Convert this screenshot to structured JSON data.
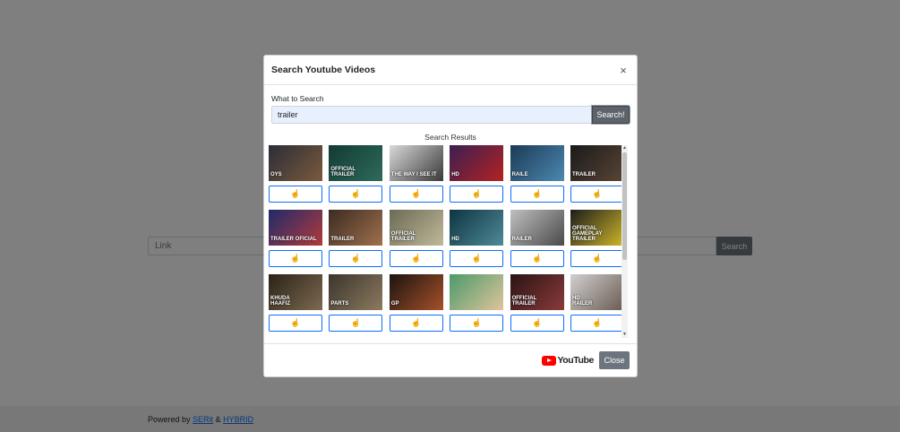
{
  "background": {
    "link_placeholder": "Link",
    "search_label": "Search",
    "footer": {
      "prefix": "Powered by ",
      "link1": "SERit",
      "sep": " & ",
      "link2": "HYBRID"
    }
  },
  "modal": {
    "title": "Search Youtube Videos",
    "close_symbol": "×",
    "field_label": "What to Search",
    "search_value": "trailer",
    "search_button": "Search!",
    "results_title": "Search Results",
    "select_icon": "pointer-hand-icon",
    "results": [
      {
        "thumb_text": "OYS",
        "c1": "#2b2d38",
        "c2": "#7a5a3c"
      },
      {
        "thumb_text": "OFFICIAL\nTRAILER",
        "c1": "#123a34",
        "c2": "#2e6b5b"
      },
      {
        "thumb_text": "THE WAY I SEE IT",
        "c1": "#d9d9d9",
        "c2": "#3a3a3a"
      },
      {
        "thumb_text": "HD",
        "c1": "#3a1f52",
        "c2": "#b32222"
      },
      {
        "thumb_text": "RAILE",
        "c1": "#1b3a56",
        "c2": "#4c88b0"
      },
      {
        "thumb_text": "TRAILER",
        "c1": "#1a1a1a",
        "c2": "#5a4536"
      },
      {
        "thumb_text": "TRAILER OFICIAL",
        "c1": "#1f2a6b",
        "c2": "#b23a3a"
      },
      {
        "thumb_text": "TRAILER",
        "c1": "#3c2b22",
        "c2": "#a0704c"
      },
      {
        "thumb_text": "OFFICIAL\nTRAILER",
        "c1": "#6b6b55",
        "c2": "#c0b89a"
      },
      {
        "thumb_text": "HD",
        "c1": "#0e3440",
        "c2": "#4f8a98"
      },
      {
        "thumb_text": "RAILER",
        "c1": "#bfbfbf",
        "c2": "#4a4a4a"
      },
      {
        "thumb_text": "OFFICIAL\nGAMEPLAY\nTRAILER",
        "c1": "#1c1c1c",
        "c2": "#d0b82a"
      },
      {
        "thumb_text": "KHUDA\nHAAFIZ",
        "c1": "#2a2218",
        "c2": "#7d6a4f"
      },
      {
        "thumb_text": "PARTS",
        "c1": "#3b352c",
        "c2": "#8c7a5f"
      },
      {
        "thumb_text": "GP",
        "c1": "#1c1410",
        "c2": "#a5502a"
      },
      {
        "thumb_text": "",
        "c1": "#4a9a6a",
        "c2": "#e0c49a"
      },
      {
        "thumb_text": "OFFICIAL\nTRAILER",
        "c1": "#2a1414",
        "c2": "#8a3a3a"
      },
      {
        "thumb_text": "HD\nRAILER",
        "c1": "#d0d0d0",
        "c2": "#6a5a50"
      }
    ],
    "youtube_logo_text": "YouTube",
    "close_button": "Close"
  }
}
